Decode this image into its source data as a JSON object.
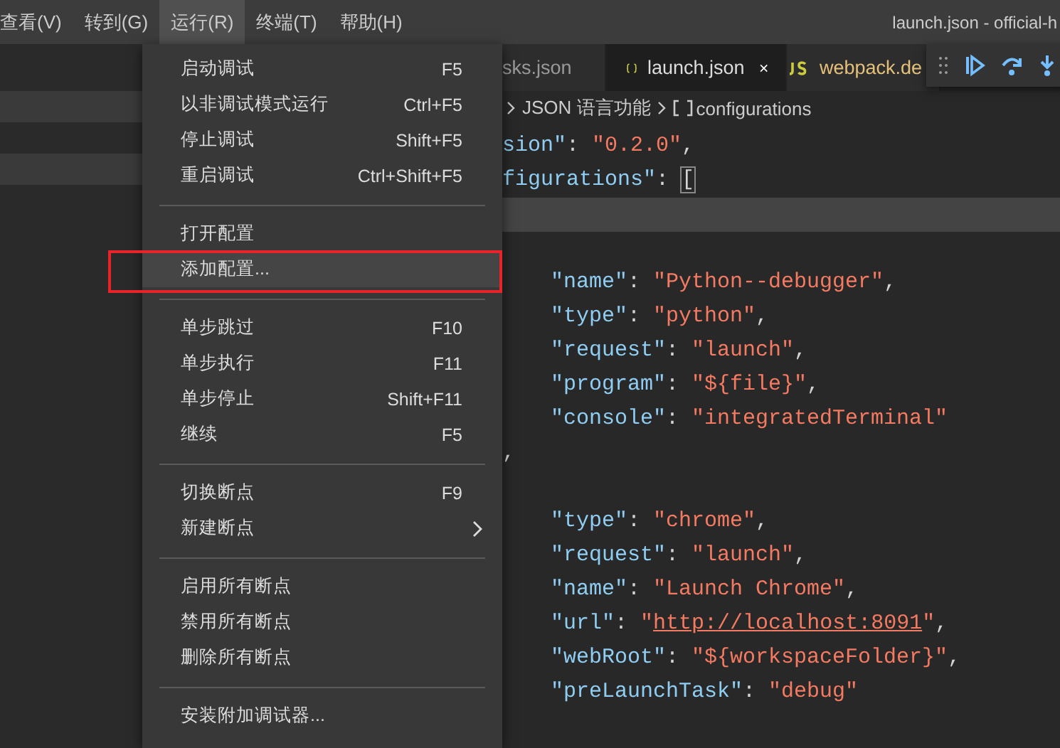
{
  "menubar": {
    "items": [
      {
        "label": "查看(V)",
        "selected": false
      },
      {
        "label": "转到(G)",
        "selected": false
      },
      {
        "label": "运行(R)",
        "selected": true
      },
      {
        "label": "终端(T)",
        "selected": false
      },
      {
        "label": "帮助(H)",
        "selected": false
      }
    ],
    "window_title": "launch.json - official-h"
  },
  "run_menu": [
    {
      "kind": "item",
      "label": "启动调试",
      "shortcut": "F5",
      "selected": false,
      "annotated": false,
      "submenu": false
    },
    {
      "kind": "item",
      "label": "以非调试模式运行",
      "shortcut": "Ctrl+F5",
      "selected": false,
      "annotated": false,
      "submenu": false
    },
    {
      "kind": "item",
      "label": "停止调试",
      "shortcut": "Shift+F5",
      "selected": false,
      "annotated": false,
      "submenu": false
    },
    {
      "kind": "item",
      "label": "重启调试",
      "shortcut": "Ctrl+Shift+F5",
      "selected": false,
      "annotated": false,
      "submenu": false
    },
    {
      "kind": "separator"
    },
    {
      "kind": "item",
      "label": "打开配置",
      "selected": false,
      "annotated": false,
      "submenu": false
    },
    {
      "kind": "item",
      "label": "添加配置...",
      "selected": true,
      "annotated": true,
      "submenu": false
    },
    {
      "kind": "separator"
    },
    {
      "kind": "item",
      "label": "单步跳过",
      "shortcut": "F10",
      "selected": false,
      "annotated": false,
      "submenu": false
    },
    {
      "kind": "item",
      "label": "单步执行",
      "shortcut": "F11",
      "selected": false,
      "annotated": false,
      "submenu": false
    },
    {
      "kind": "item",
      "label": "单步停止",
      "shortcut": "Shift+F11",
      "selected": false,
      "annotated": false,
      "submenu": false
    },
    {
      "kind": "item",
      "label": "继续",
      "shortcut": "F5",
      "selected": false,
      "annotated": false,
      "submenu": false
    },
    {
      "kind": "separator"
    },
    {
      "kind": "item",
      "label": "切换断点",
      "shortcut": "F9",
      "selected": false,
      "annotated": false,
      "submenu": false
    },
    {
      "kind": "item",
      "label": "新建断点",
      "selected": false,
      "annotated": false,
      "submenu": true
    },
    {
      "kind": "separator"
    },
    {
      "kind": "item",
      "label": "启用所有断点",
      "selected": false,
      "annotated": false,
      "submenu": false
    },
    {
      "kind": "item",
      "label": "禁用所有断点",
      "selected": false,
      "annotated": false,
      "submenu": false
    },
    {
      "kind": "item",
      "label": "删除所有断点",
      "selected": false,
      "annotated": false,
      "submenu": false
    },
    {
      "kind": "separator"
    },
    {
      "kind": "item",
      "label": "安装附加调试器...",
      "selected": false,
      "annotated": false,
      "submenu": false
    }
  ],
  "tabs": [
    {
      "label": "sks.json",
      "kind": "plain",
      "selected": false,
      "closable": false
    },
    {
      "label": "launch.json",
      "kind": "json",
      "selected": true,
      "closable": true
    },
    {
      "label": "webpack.de",
      "kind": "js",
      "selected": false,
      "closable": false
    }
  ],
  "breadcrumb": {
    "items": [
      {
        "label": "JSON 语言功能",
        "kind": "text"
      },
      {
        "label": "configurations",
        "kind": "array"
      }
    ]
  },
  "editor_lines": [
    {
      "kind": "top",
      "current": false,
      "tokens": [
        {
          "kind": "key",
          "text": "sion\""
        },
        {
          "kind": "punct",
          "text": ": "
        },
        {
          "kind": "string",
          "text": "\"0.2.0\""
        },
        {
          "kind": "punct",
          "text": ","
        }
      ]
    },
    {
      "kind": "top",
      "current": false,
      "tokens": [
        {
          "kind": "key",
          "text": "figurations\""
        },
        {
          "kind": "punct",
          "text": ": "
        },
        {
          "kind": "bracket",
          "text": "["
        }
      ]
    },
    {
      "kind": "blank",
      "current": true
    },
    {
      "kind": "blank"
    },
    {
      "kind": "entry",
      "current": false,
      "tokens": [
        {
          "kind": "key",
          "text": "\"name\""
        },
        {
          "kind": "punct",
          "text": ": "
        },
        {
          "kind": "string",
          "text": "\"Python--debugger\""
        },
        {
          "kind": "punct",
          "text": ","
        }
      ]
    },
    {
      "kind": "entry",
      "current": false,
      "tokens": [
        {
          "kind": "key",
          "text": "\"type\""
        },
        {
          "kind": "punct",
          "text": ": "
        },
        {
          "kind": "string",
          "text": "\"python\""
        },
        {
          "kind": "punct",
          "text": ","
        }
      ]
    },
    {
      "kind": "entry",
      "current": false,
      "tokens": [
        {
          "kind": "key",
          "text": "\"request\""
        },
        {
          "kind": "punct",
          "text": ": "
        },
        {
          "kind": "string",
          "text": "\"launch\""
        },
        {
          "kind": "punct",
          "text": ","
        }
      ]
    },
    {
      "kind": "entry",
      "current": false,
      "tokens": [
        {
          "kind": "key",
          "text": "\"program\""
        },
        {
          "kind": "punct",
          "text": ": "
        },
        {
          "kind": "string",
          "text": "\"${file}\""
        },
        {
          "kind": "punct",
          "text": ","
        }
      ]
    },
    {
      "kind": "entry",
      "current": false,
      "tokens": [
        {
          "kind": "key",
          "text": "\"console\""
        },
        {
          "kind": "punct",
          "text": ": "
        },
        {
          "kind": "string",
          "text": "\"integratedTerminal\""
        }
      ]
    },
    {
      "kind": "top",
      "current": false,
      "tokens": [
        {
          "kind": "punct",
          "text": ","
        }
      ]
    },
    {
      "kind": "blank"
    },
    {
      "kind": "entry",
      "current": false,
      "tokens": [
        {
          "kind": "key",
          "text": "\"type\""
        },
        {
          "kind": "punct",
          "text": ": "
        },
        {
          "kind": "string",
          "text": "\"chrome\""
        },
        {
          "kind": "punct",
          "text": ","
        }
      ]
    },
    {
      "kind": "entry",
      "current": false,
      "tokens": [
        {
          "kind": "key",
          "text": "\"request\""
        },
        {
          "kind": "punct",
          "text": ": "
        },
        {
          "kind": "string",
          "text": "\"launch\""
        },
        {
          "kind": "punct",
          "text": ","
        }
      ]
    },
    {
      "kind": "entry",
      "current": false,
      "tokens": [
        {
          "kind": "key",
          "text": "\"name\""
        },
        {
          "kind": "punct",
          "text": ": "
        },
        {
          "kind": "string",
          "text": "\"Launch Chrome\""
        },
        {
          "kind": "punct",
          "text": ","
        }
      ]
    },
    {
      "kind": "entry",
      "current": false,
      "tokens": [
        {
          "kind": "key",
          "text": "\"url\""
        },
        {
          "kind": "punct",
          "text": ": "
        },
        {
          "kind": "string",
          "text": "\""
        },
        {
          "kind": "link",
          "text": "http://localhost:8091"
        },
        {
          "kind": "string",
          "text": "\""
        },
        {
          "kind": "punct",
          "text": ","
        }
      ]
    },
    {
      "kind": "entry",
      "current": false,
      "tokens": [
        {
          "kind": "key",
          "text": "\"webRoot\""
        },
        {
          "kind": "punct",
          "text": ": "
        },
        {
          "kind": "string",
          "text": "\"${workspaceFolder}\""
        },
        {
          "kind": "punct",
          "text": ","
        }
      ]
    },
    {
      "kind": "entry",
      "current": false,
      "tokens": [
        {
          "kind": "key",
          "text": "\"preLaunchTask\""
        },
        {
          "kind": "punct",
          "text": ": "
        },
        {
          "kind": "string",
          "text": "\"debug\""
        }
      ]
    }
  ]
}
